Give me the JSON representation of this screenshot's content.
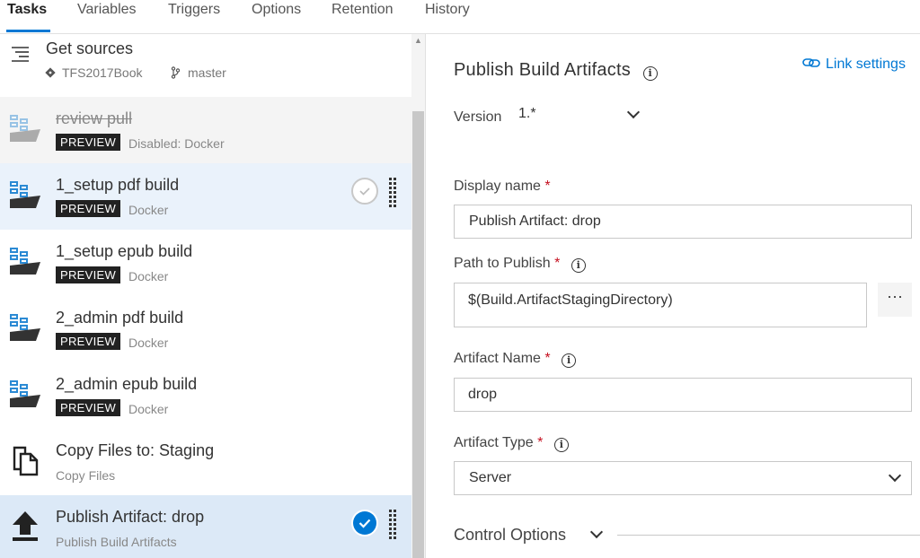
{
  "tabs": [
    {
      "label": "Tasks",
      "active": true
    },
    {
      "label": "Variables"
    },
    {
      "label": "Triggers"
    },
    {
      "label": "Options"
    },
    {
      "label": "Retention"
    },
    {
      "label": "History"
    }
  ],
  "get_sources": {
    "title": "Get sources",
    "repo": "TFS2017Book",
    "branch": "master"
  },
  "tasks": [
    {
      "title": "review pull",
      "badge": "PREVIEW",
      "subtitle": "Disabled: Docker",
      "state": "disabled"
    },
    {
      "title": "1_setup pdf build",
      "badge": "PREVIEW",
      "subtitle": "Docker",
      "state": "hover"
    },
    {
      "title": "1_setup epub build",
      "badge": "PREVIEW",
      "subtitle": "Docker"
    },
    {
      "title": "2_admin pdf build",
      "badge": "PREVIEW",
      "subtitle": "Docker"
    },
    {
      "title": "2_admin epub build",
      "badge": "PREVIEW",
      "subtitle": "Docker"
    },
    {
      "title": "Copy Files to: Staging",
      "subtitle": "Copy Files"
    },
    {
      "title": "Publish Artifact: drop",
      "subtitle": "Publish Build Artifacts",
      "state": "selected"
    }
  ],
  "details": {
    "title": "Publish Build Artifacts",
    "link_settings": "Link settings",
    "version_label": "Version",
    "version_value": "1.*",
    "display_name_label": "Display name",
    "display_name_value": "Publish Artifact: drop",
    "path_label": "Path to Publish",
    "path_value": "$(Build.ArtifactStagingDirectory)",
    "path_browse": "···",
    "artifact_name_label": "Artifact Name",
    "artifact_name_value": "drop",
    "artifact_type_label": "Artifact Type",
    "artifact_type_value": "Server",
    "control_options": "Control Options",
    "required_mark": "*",
    "info_glyph": "i"
  },
  "colors": {
    "accent": "#0078d4",
    "required": "#c50f1f",
    "selected_row": "#dce9f7",
    "hover_row": "#eaf2fb"
  }
}
